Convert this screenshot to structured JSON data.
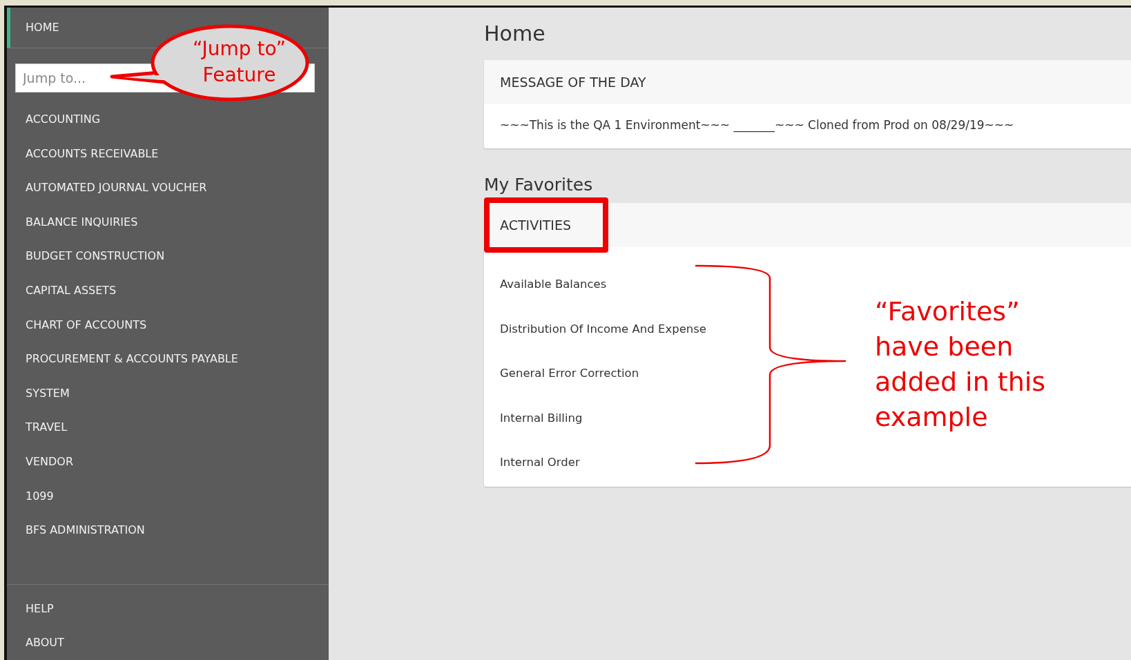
{
  "sidebar": {
    "top_items": [
      {
        "label": "HOME",
        "selected": true
      }
    ],
    "search": {
      "placeholder": "Jump to..."
    },
    "modules": [
      {
        "label": "ACCOUNTING",
        "selected": false
      },
      {
        "label": "ACCOUNTS RECEIVABLE",
        "selected": false
      },
      {
        "label": "AUTOMATED JOURNAL VOUCHER",
        "selected": false
      },
      {
        "label": "BALANCE INQUIRIES",
        "selected": false
      },
      {
        "label": "BUDGET CONSTRUCTION",
        "selected": false
      },
      {
        "label": "CAPITAL ASSETS",
        "selected": false
      },
      {
        "label": "CHART OF ACCOUNTS",
        "selected": false
      },
      {
        "label": "PROCUREMENT & ACCOUNTS PAYABLE",
        "selected": false
      },
      {
        "label": "SYSTEM",
        "selected": false
      },
      {
        "label": "TRAVEL",
        "selected": false
      },
      {
        "label": "VENDOR",
        "selected": false
      },
      {
        "label": "1099",
        "selected": false
      },
      {
        "label": "BFS ADMINISTRATION",
        "selected": false
      }
    ],
    "bottom_items": [
      {
        "label": "HELP",
        "selected": false
      },
      {
        "label": "ABOUT",
        "selected": false
      }
    ]
  },
  "main": {
    "title": "Home",
    "motd": {
      "header": "MESSAGE OF THE DAY",
      "text": "~~~This is the QA 1 Environment~~~ _______~~~ Cloned from Prod on 08/29/19~~~"
    },
    "favorites": {
      "title": "My Favorites",
      "header": "ACTIVITIES",
      "highlighted": true,
      "items": [
        "Available Balances",
        "Distribution Of Income And Expense",
        "General Error Correction",
        "Internal Billing",
        "Internal Order"
      ]
    }
  },
  "callout": {
    "lines": [
      "“Jump to”",
      "Feature"
    ]
  },
  "brace_note": {
    "lines": [
      "“Favorites”",
      "have been",
      "added in this",
      "example"
    ]
  }
}
